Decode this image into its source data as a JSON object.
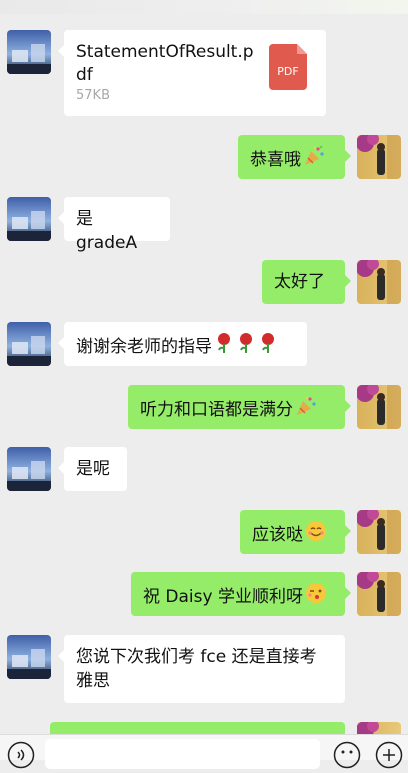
{
  "file_message": {
    "filename": "StatementOfResult.pdf",
    "size": "57KB",
    "icon_label": "PDF"
  },
  "messages": [
    {
      "text": "恭喜哦",
      "emoji": "party-popper-icon"
    },
    {
      "text": "是 gradeA"
    },
    {
      "text": "太好了"
    },
    {
      "text": "谢谢余老师的指导",
      "emoji": "rose-icon"
    },
    {
      "text": "听力和口语都是满分",
      "emoji": "party-popper-icon"
    },
    {
      "text": "是呢"
    },
    {
      "text": "应该哒",
      "emoji": "smile-icon"
    },
    {
      "text": "祝 Daisy 学业顺利呀",
      "emoji": "wink-kiss-icon"
    },
    {
      "text_line1": "您说下次我们考 fce 还是直接考",
      "text_line2": "雅思"
    }
  ],
  "colors": {
    "background": "#ededed",
    "incoming_bubble": "#ffffff",
    "outgoing_bubble": "#95ec69",
    "pdf_red": "#e05a4e"
  }
}
